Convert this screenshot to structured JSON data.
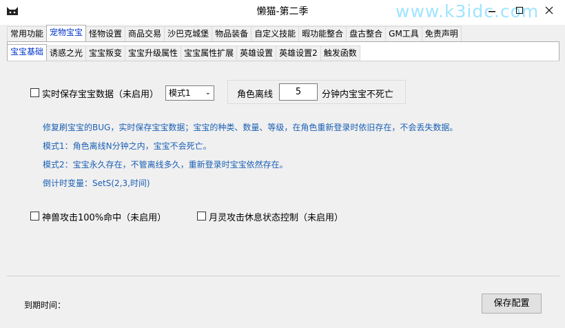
{
  "window": {
    "title": "懒猫-第二季",
    "watermark": "www.k3idc.com"
  },
  "main_tabs": [
    "常用功能",
    "宠物宝宝",
    "怪物设置",
    "商品交易",
    "沙巴克城堡",
    "物品装备",
    "自定义技能",
    "暇功能整合",
    "盘古整合",
    "GM工具",
    "免责声明"
  ],
  "main_tab_active": "宠物宝宝",
  "sub_tabs": [
    "宝宝基础",
    "诱惑之光",
    "宝宝叛变",
    "宝宝升级属性",
    "宝宝属性扩展",
    "英雄设置",
    "英雄设置2",
    "触发函数"
  ],
  "sub_tab_active": "宝宝基础",
  "realtime_save": {
    "label": "实时保存宝宝数据（未启用）",
    "checked": false
  },
  "mode_select": {
    "value": "模式1"
  },
  "offline": {
    "prefix": "角色离线",
    "value": "5",
    "suffix": "分钟内宝宝不死亡"
  },
  "info_lines": [
    "修复刷宝宝的BUG，实时保存宝宝数据；宝宝的种类、数量、等级，在角色重新登录时依旧存在，不会丢失数据。",
    "模式1：角色离线N分钟之内，宝宝不会死亡。",
    "模式2：宝宝永久存在，不管离线多久，重新登录时宝宝依然存在。",
    "倒计时变量：SetS(2,3,时间)"
  ],
  "beast_hit": {
    "label": "神兽攻击100%命中（未启用）",
    "checked": false
  },
  "moon_spirit": {
    "label": "月灵攻击休息状态控制（未启用）",
    "checked": false
  },
  "footer": {
    "expiry_label": "到期时间：",
    "save_label": "保存配置"
  }
}
